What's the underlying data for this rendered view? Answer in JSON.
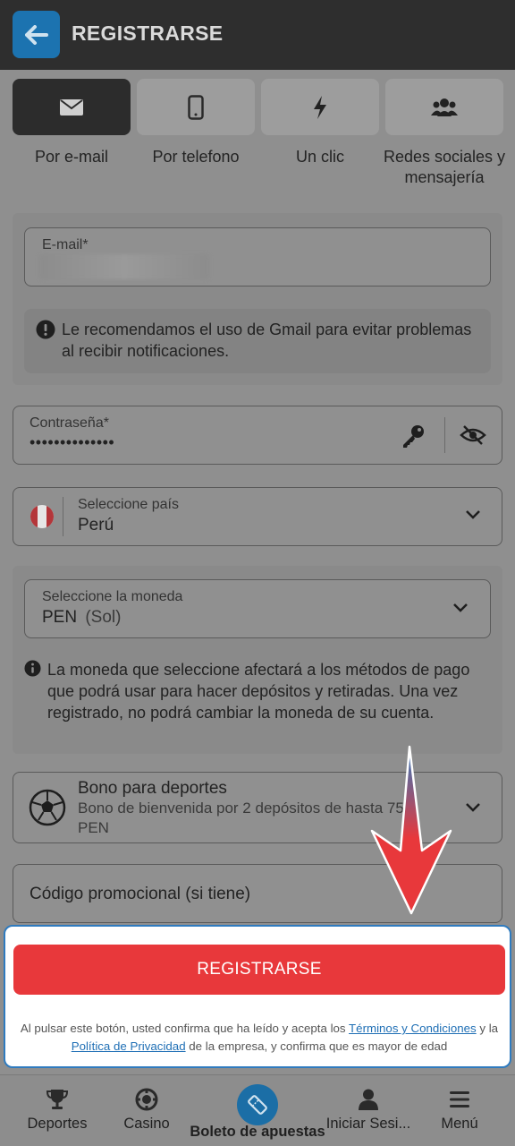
{
  "header": {
    "title": "REGISTRARSE"
  },
  "tabs": [
    {
      "label": "Por e-mail",
      "icon": "envelope-icon",
      "active": true
    },
    {
      "label": "Por telefono",
      "icon": "smartphone-icon",
      "active": false
    },
    {
      "label": "Un clic",
      "icon": "lightning-icon",
      "active": false
    },
    {
      "label": "Redes sociales y mensajería",
      "icon": "users-icon",
      "active": false
    }
  ],
  "email": {
    "label": "E-mail*",
    "note": "Le recomendamos el uso de Gmail para evitar problemas al recibir notificaciones."
  },
  "password": {
    "label": "Contraseña*",
    "value": "••••••••••••••"
  },
  "country": {
    "label": "Seleccione país",
    "value": "Perú"
  },
  "currency": {
    "label": "Seleccione la moneda",
    "code": "PEN",
    "name": "(Sol)",
    "note": "La moneda que seleccione afectará a los métodos de pago que podrá usar para hacer depósitos y retiradas. Una vez registrado, no podrá cambiar la moneda de su cuenta."
  },
  "bonus": {
    "title": "Bono para deportes",
    "description": "Bono de bienvenida por 2 depósitos de hasta 750 PEN"
  },
  "promo": {
    "label": "Código promocional (si tiene)"
  },
  "register": {
    "button_label": "REGISTRARSE",
    "legal_pre": "Al pulsar este botón, usted confirma que ha leído y acepta los ",
    "terms_link": "Términos y Condiciones",
    "legal_mid": " y la ",
    "privacy_link": "Política de Privacidad",
    "legal_post": " de la empresa, y confirma que es mayor de edad"
  },
  "bottom_nav": [
    {
      "label": "Deportes",
      "icon": "trophy-icon"
    },
    {
      "label": "Casino",
      "icon": "casino-chip-icon"
    },
    {
      "label": "Boleto de apuestas",
      "icon": "ticket-icon"
    },
    {
      "label": "Iniciar Sesi...",
      "icon": "user-icon"
    },
    {
      "label": "Menú",
      "icon": "menu-icon"
    }
  ],
  "colors": {
    "brand_blue": "#1c73b0",
    "register_red": "#e8383b",
    "link_blue": "#1f6fb5",
    "header_bg": "#2e2e2e"
  }
}
